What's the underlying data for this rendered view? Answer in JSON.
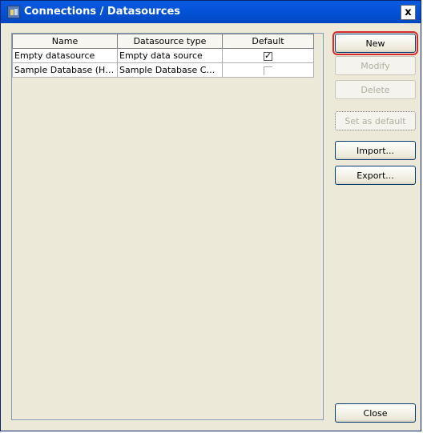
{
  "window": {
    "title": "Connections / Datasources",
    "close_symbol": "x"
  },
  "table": {
    "columns": [
      "Name",
      "Datasource type",
      "Default"
    ],
    "rows": [
      {
        "name": "Empty datasource",
        "type": "Empty data source",
        "default": true
      },
      {
        "name": "Sample Database (HS…",
        "type": "Sample Database Con…",
        "default": false
      }
    ]
  },
  "buttons": {
    "new": "New",
    "modify": "Modify",
    "delete": "Delete",
    "set_default": "Set as default",
    "import": "Import...",
    "export": "Export...",
    "close": "Close"
  },
  "checkmark": "✓",
  "colors": {
    "title_bar": "#0350d4",
    "highlight_outline": "#d92a2a",
    "dialog_bg": "#ece9d8"
  }
}
